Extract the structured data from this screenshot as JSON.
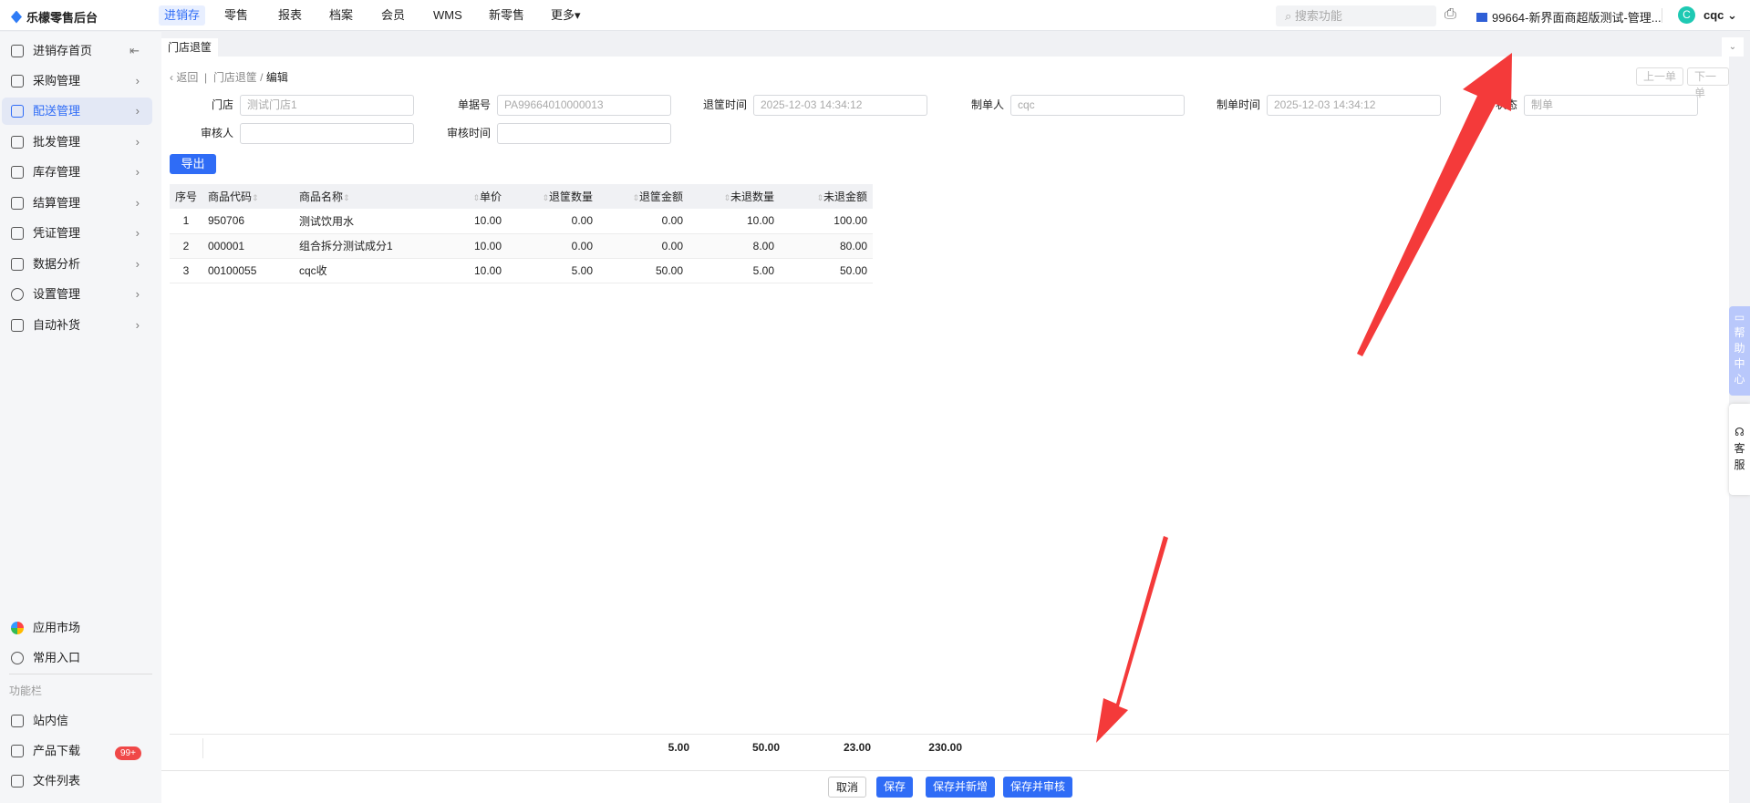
{
  "app": {
    "title": "乐檬零售后台"
  },
  "topnav": [
    "进销存",
    "零售",
    "报表",
    "档案",
    "会员",
    "WMS",
    "新零售",
    "更多▾"
  ],
  "header": {
    "search_placeholder": "搜索功能",
    "store": "99664-新界面商超版测试-管理...",
    "user_initial": "C",
    "user": "cqc"
  },
  "sidebar": {
    "items": [
      {
        "label": "进销存首页",
        "icon": "home-icon"
      },
      {
        "label": "采购管理",
        "icon": "cart-icon"
      },
      {
        "label": "配送管理",
        "icon": "map-icon"
      },
      {
        "label": "批发管理",
        "icon": "box-icon"
      },
      {
        "label": "库存管理",
        "icon": "inventory-icon"
      },
      {
        "label": "结算管理",
        "icon": "money-icon"
      },
      {
        "label": "凭证管理",
        "icon": "doc-icon"
      },
      {
        "label": "数据分析",
        "icon": "chart-icon"
      },
      {
        "label": "设置管理",
        "icon": "gear-icon"
      },
      {
        "label": "自动补货",
        "icon": "restock-icon"
      }
    ],
    "app_market": "应用市场",
    "favorites": "常用入口",
    "section": "功能栏",
    "messages": "站内信",
    "badge": "99+",
    "download": "产品下载",
    "files": "文件列表"
  },
  "tab": "门店退筐",
  "breadcrumb": {
    "back": "返回",
    "parent": "门店退筐",
    "current": "编辑"
  },
  "pager": {
    "prev": "上一单",
    "next": "下一单"
  },
  "form": {
    "store": {
      "label": "门店",
      "value": "测试门店1"
    },
    "doc_no": {
      "label": "单据号",
      "value": "PA99664010000013"
    },
    "return_time": {
      "label": "退筐时间",
      "value": "2025-12-03 14:34:12"
    },
    "creator": {
      "label": "制单人",
      "value": "cqc"
    },
    "create_time": {
      "label": "制单时间",
      "value": "2025-12-03 14:34:12"
    },
    "status": {
      "label": "状态",
      "value": "制单"
    },
    "auditor": {
      "label": "审核人",
      "value": ""
    },
    "audit_time": {
      "label": "审核时间",
      "value": ""
    }
  },
  "export": "导出",
  "table": {
    "headers": [
      "序号",
      "商品代码",
      "商品名称",
      "单价",
      "退筐数量",
      "退筐金额",
      "未退数量",
      "未退金额"
    ],
    "rows": [
      [
        "1",
        "950706",
        "测试饮用水",
        "10.00",
        "0.00",
        "0.00",
        "10.00",
        "100.00"
      ],
      [
        "2",
        "000001",
        "组合拆分测试成分1",
        "10.00",
        "0.00",
        "0.00",
        "8.00",
        "80.00"
      ],
      [
        "3",
        "00100055",
        "cqc收",
        "10.00",
        "5.00",
        "50.00",
        "5.00",
        "50.00"
      ]
    ],
    "totals": [
      "5.00",
      "50.00",
      "23.00",
      "230.00"
    ]
  },
  "actions": {
    "cancel": "取消",
    "save": "保存",
    "save_new": "保存并新增",
    "save_audit": "保存并审核"
  },
  "float": {
    "help": [
      "帮",
      "助",
      "中",
      "心"
    ],
    "service": [
      "客",
      "服"
    ]
  }
}
